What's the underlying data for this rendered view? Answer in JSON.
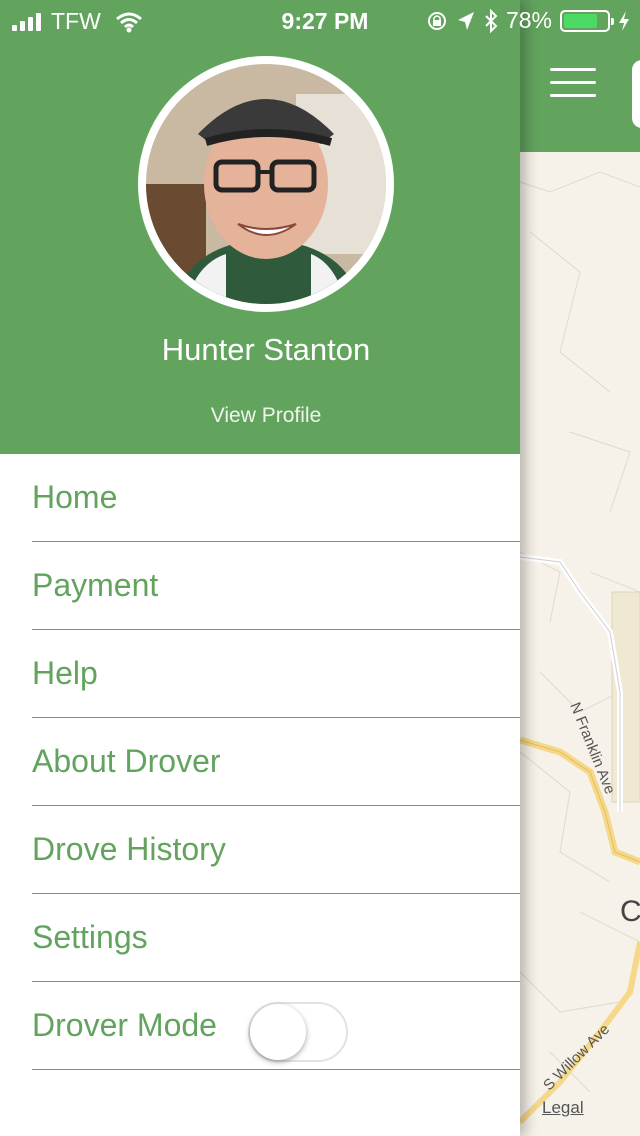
{
  "status_bar": {
    "carrier": "TFW",
    "time": "9:27 PM",
    "battery_percent": "78%",
    "battery_level": 0.78,
    "battery_color": "#4cd964"
  },
  "theme": {
    "accent": "#62a35e"
  },
  "profile": {
    "name": "Hunter Stanton",
    "view_profile_label": "View Profile"
  },
  "menu": {
    "items": [
      {
        "label": "Home"
      },
      {
        "label": "Payment"
      },
      {
        "label": "Help"
      },
      {
        "label": "About Drover"
      },
      {
        "label": "Drove History"
      },
      {
        "label": "Settings"
      },
      {
        "label": "Drover Mode",
        "toggle": false
      }
    ]
  },
  "map": {
    "labels": {
      "street_1": "N Franklin Ave",
      "street_2": "S Willow Ave",
      "place_partial": "C"
    },
    "legal": "Legal"
  }
}
